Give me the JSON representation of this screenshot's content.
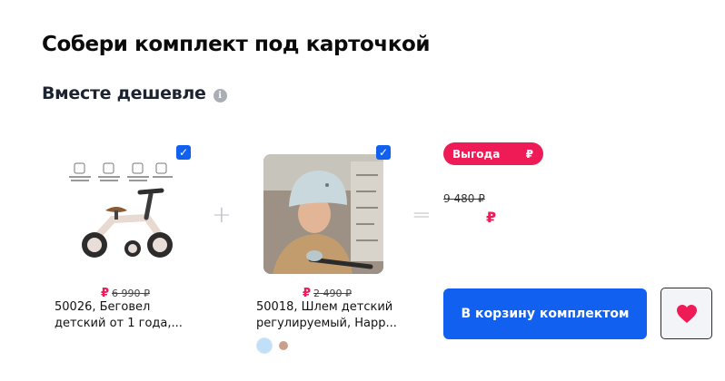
{
  "section": {
    "title": "Собери комплект под карточкой",
    "subtitle": "Вместе дешевле",
    "info_icon": "i"
  },
  "products": [
    {
      "checked": true,
      "currency": "₽",
      "old_price": "6 990 ₽",
      "name_line1": "50026, Беговел",
      "name_line2": "детский от 1 года,...",
      "image_icon": "balance-bike-image"
    },
    {
      "checked": true,
      "currency": "₽",
      "old_price": "2 490 ₽",
      "name_line1": "50018, Шлем детский",
      "name_line2": "регулируемый, Happ...",
      "image_icon": "helmet-photo",
      "swatch_colors": [
        "#bfe0f8",
        "#caa08a"
      ]
    }
  ],
  "operators": {
    "plus": "+",
    "equals": "="
  },
  "bundle": {
    "badge_label": "Выгода",
    "badge_currency": "₽",
    "old_total": "9 480 ₽",
    "new_total": "₽",
    "add_to_cart_label": "В корзину комплектом",
    "favorite_icon": "heart-icon"
  },
  "colors": {
    "accent_blue": "#1160f0",
    "accent_pink": "#ef1b56"
  }
}
